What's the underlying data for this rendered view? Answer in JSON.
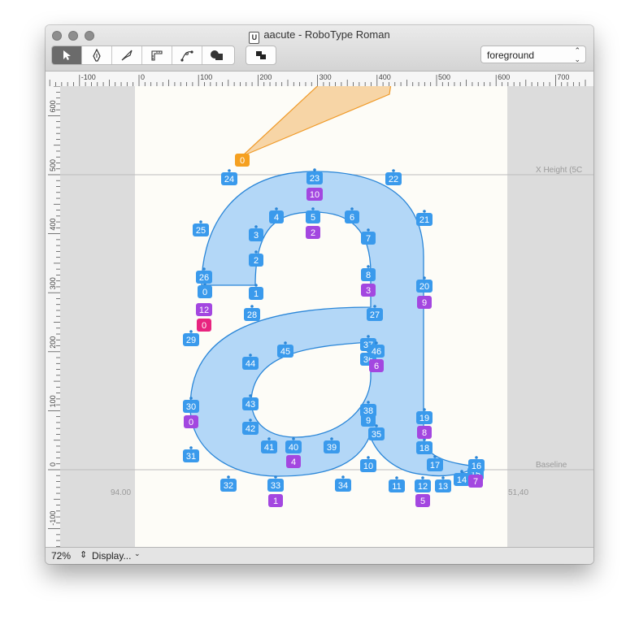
{
  "window": {
    "title": "aacute - RoboType Roman",
    "doc_icon_glyph": "U"
  },
  "toolbar": {
    "tools": [
      "pointer-tool",
      "pen-tool",
      "knife-tool",
      "measure-tool",
      "shape-tool",
      "bezier-tool"
    ],
    "layer_select": {
      "value": "foreground"
    }
  },
  "ruler": {
    "top_ticks": [
      "-100",
      "0",
      "100",
      "200",
      "300",
      "400",
      "500",
      "600",
      "700"
    ],
    "left_ticks": [
      "600",
      "500",
      "400",
      "300",
      "200",
      "100",
      "0",
      "-100"
    ]
  },
  "canvas": {
    "guides": {
      "xheight": "X Height (5C",
      "baseline": "Baseline"
    },
    "sidebearings": {
      "left": "94.00",
      "right": "51,40"
    },
    "anchor_label": "0",
    "point_labels": [
      "0",
      "1",
      "2",
      "3",
      "4",
      "5",
      "6",
      "7",
      "8",
      "9",
      "10",
      "11",
      "12",
      "13",
      "14",
      "15",
      "16",
      "17",
      "18",
      "19",
      "20",
      "21",
      "22",
      "23",
      "24",
      "25",
      "26",
      "27",
      "28",
      "29",
      "30",
      "31",
      "32",
      "33",
      "34",
      "35",
      "36",
      "37",
      "38",
      "39",
      "40",
      "41",
      "42",
      "43",
      "44",
      "45",
      "46"
    ],
    "contour_labels": [
      "0",
      "1",
      "2",
      "3",
      "4",
      "5",
      "6",
      "7",
      "8",
      "9",
      "10",
      "12",
      "0"
    ]
  },
  "status": {
    "zoom": "72%",
    "display_menu": "Display..."
  },
  "colors": {
    "glyph_fill": "#b3d7f7",
    "glyph_stroke": "#2a86d8",
    "point_badge": "#3a9aec",
    "segment_badge": "#a347e0",
    "anchor_badge": "#f5a020",
    "accent_pink": "#e8247f"
  }
}
